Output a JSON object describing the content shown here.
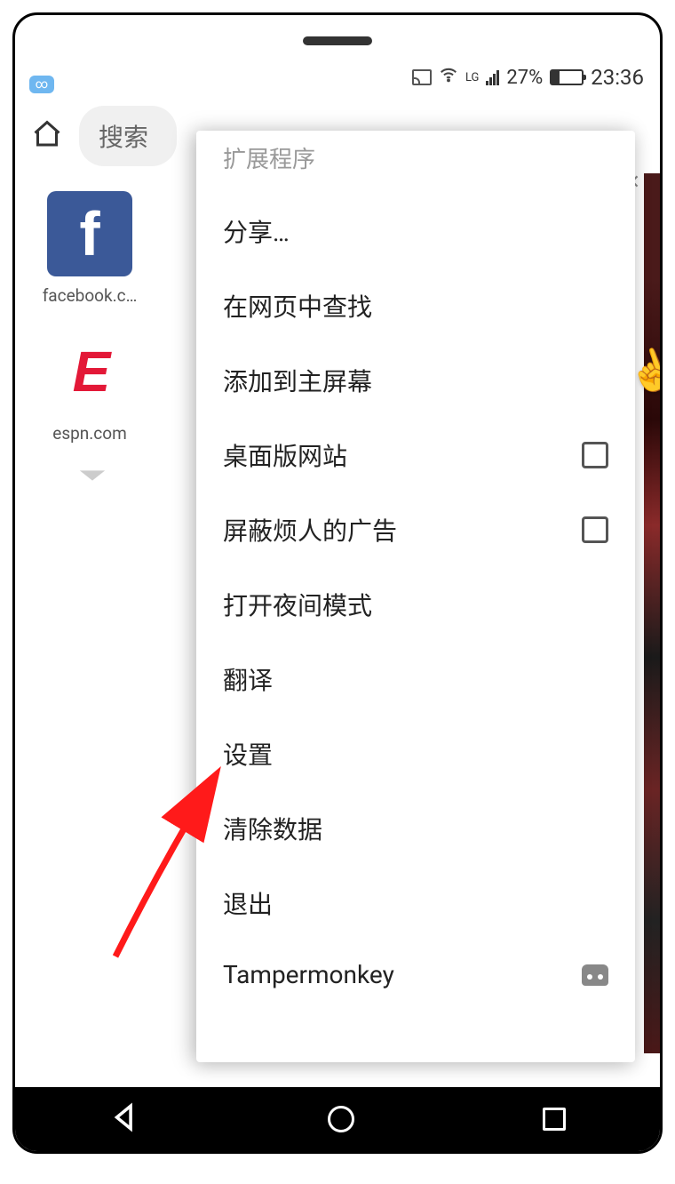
{
  "status": {
    "signal_label": "LG",
    "battery_pct": "27%",
    "time": "23:36"
  },
  "browser": {
    "search_placeholder": "搜索"
  },
  "shortcuts": [
    {
      "label": "facebook.c…"
    },
    {
      "label": "espn.com"
    }
  ],
  "menu": {
    "extensions": "扩展程序",
    "share": "分享…",
    "find_in_page": "在网页中查找",
    "add_to_home": "添加到主屏幕",
    "desktop_site": "桌面版网站",
    "block_ads": "屏蔽烦人的广告",
    "night_mode": "打开夜间模式",
    "translate": "翻译",
    "settings": "设置",
    "clear_data": "清除数据",
    "quit": "退出",
    "tampermonkey": "Tampermonkey"
  },
  "checkboxes": {
    "desktop_site": false,
    "block_ads": false
  }
}
